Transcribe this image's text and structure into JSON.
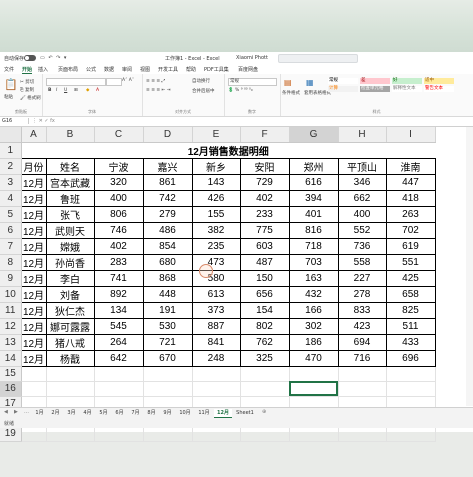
{
  "titlebar": {
    "autosave_label": "自动保存",
    "file_title": "工作簿1 - Excel - Excel",
    "user_name": "Xiaomi Phott"
  },
  "menu": [
    "文件",
    "开始",
    "插入",
    "页面布局",
    "公式",
    "数据",
    "审阅",
    "视图",
    "开发工具",
    "帮助",
    "PDF工具集",
    "百度网盘"
  ],
  "active_menu_index": 1,
  "ribbon": {
    "clipboard_label": "剪贴板",
    "font_label": "字体",
    "alignment_label": "对齐方式",
    "number_label": "数字",
    "styles_label": "样式",
    "number_format": "常规",
    "paste_label": "粘贴",
    "cond_format_label": "条件格式",
    "table_format_label": "套用表格格式",
    "cell_styles": [
      {
        "text": "常规",
        "bg": "#ffffff",
        "fg": "#000000"
      },
      {
        "text": "差",
        "bg": "#ffc7ce",
        "fg": "#9c0006"
      },
      {
        "text": "好",
        "bg": "#c6efce",
        "fg": "#006100"
      },
      {
        "text": "适中",
        "bg": "#ffeb9c",
        "fg": "#9c5700"
      },
      {
        "text": "计算",
        "bg": "#f2f2f2",
        "fg": "#fa7d00"
      },
      {
        "text": "检查单元格",
        "bg": "#a5a5a5",
        "fg": "#ffffff"
      },
      {
        "text": "解释性文本",
        "bg": "#ffffff",
        "fg": "#7f7f7f"
      },
      {
        "text": "警告文本",
        "bg": "#ffffff",
        "fg": "#ff0000"
      }
    ]
  },
  "formula_bar": {
    "name_box": "G16",
    "content": ""
  },
  "columns": [
    "A",
    "B",
    "C",
    "D",
    "E",
    "F",
    "G",
    "H",
    "I"
  ],
  "selected_column": "G",
  "rows": [
    "1",
    "2",
    "3",
    "4",
    "5",
    "6",
    "7",
    "8",
    "9",
    "10",
    "11",
    "12",
    "13",
    "14",
    "15",
    "16",
    "17",
    "18",
    "19"
  ],
  "selected_row": "16",
  "sheet_title": "12月销售数据明细",
  "headers": [
    "月份",
    "姓名",
    "宁波",
    "嘉兴",
    "新乡",
    "安阳",
    "郑州",
    "平顶山",
    "淮南"
  ],
  "data_rows": [
    [
      "12月",
      "宫本武藏",
      "320",
      "861",
      "143",
      "729",
      "616",
      "346",
      "447"
    ],
    [
      "12月",
      "鲁班",
      "400",
      "742",
      "426",
      "402",
      "394",
      "662",
      "418"
    ],
    [
      "12月",
      "张飞",
      "806",
      "279",
      "155",
      "233",
      "401",
      "400",
      "263"
    ],
    [
      "12月",
      "武则天",
      "746",
      "486",
      "382",
      "775",
      "816",
      "552",
      "702"
    ],
    [
      "12月",
      "嫦娥",
      "402",
      "854",
      "235",
      "603",
      "718",
      "736",
      "619"
    ],
    [
      "12月",
      "孙尚香",
      "283",
      "680",
      "473",
      "487",
      "703",
      "558",
      "551"
    ],
    [
      "12月",
      "李白",
      "741",
      "868",
      "580",
      "150",
      "163",
      "227",
      "425"
    ],
    [
      "12月",
      "刘备",
      "892",
      "448",
      "613",
      "656",
      "432",
      "278",
      "658"
    ],
    [
      "12月",
      "狄仁杰",
      "134",
      "191",
      "373",
      "154",
      "166",
      "833",
      "825"
    ],
    [
      "12月",
      "娜可露露",
      "545",
      "530",
      "887",
      "802",
      "302",
      "423",
      "511"
    ],
    [
      "12月",
      "猪八戒",
      "264",
      "721",
      "841",
      "762",
      "186",
      "694",
      "433"
    ],
    [
      "12月",
      "杨戬",
      "642",
      "670",
      "248",
      "325",
      "470",
      "716",
      "696"
    ]
  ],
  "sheet_tabs": [
    "1月",
    "2月",
    "3月",
    "4月",
    "5月",
    "6月",
    "7月",
    "8月",
    "9月",
    "10月",
    "11月",
    "12月",
    "Sheet1"
  ],
  "active_sheet": "12月",
  "status_text": "就绪"
}
